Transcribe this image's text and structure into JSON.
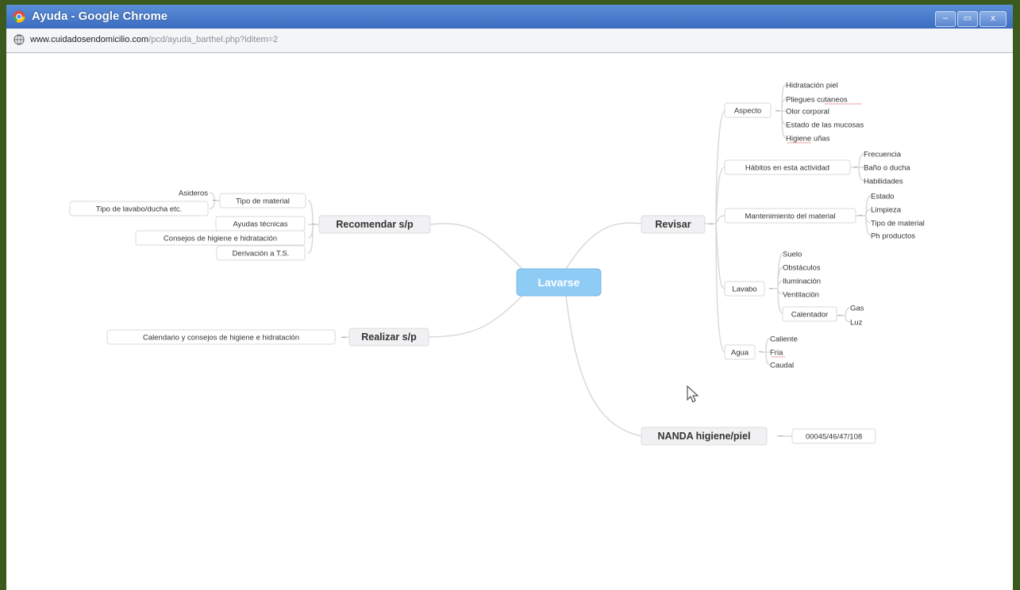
{
  "window": {
    "title": "Ayuda - Google Chrome",
    "controls": {
      "minimize": "–",
      "maximize": "▭",
      "close": "x"
    }
  },
  "address": {
    "domain": "www.cuidadosendomicilio.com",
    "path": "/pcd/ayuda_barthel.php?iditem=2"
  },
  "mindmap": {
    "central": "Lavarse",
    "revisar": {
      "label": "Revisar",
      "aspecto": {
        "label": "Aspecto",
        "items": [
          "Hidratación piel",
          "Pliegues cutaneos",
          "Olor corporal",
          "Estado de las mucosas",
          "Higiene uñas"
        ]
      },
      "habitos": {
        "label": "Hábitos en esta actividad",
        "items": [
          "Frecuencia",
          "Baño o ducha",
          "Habilidades"
        ]
      },
      "mantenimiento": {
        "label": "Mantenimiento del material",
        "items": [
          "Estado",
          "Limpieza",
          "Tipo de material",
          "Ph productos"
        ]
      },
      "lavabo": {
        "label": "Lavabo",
        "items": [
          "Suelo",
          "Obstáculos",
          "Iluminación",
          "Ventilación"
        ],
        "calentador": {
          "label": "Calentador",
          "items": [
            "Gas",
            "Luz"
          ]
        }
      },
      "agua": {
        "label": "Agua",
        "items": [
          "Caliente",
          "Fria",
          "Caudal"
        ]
      }
    },
    "nanda": {
      "label": "NANDA higiene/piel",
      "code": "00045/46/47/108"
    },
    "recomendar": {
      "label": "Recomendar s/p",
      "tipo_material": {
        "label": "Tipo de material",
        "items": [
          "Asideros",
          "Tipo de lavabo/ducha etc."
        ]
      },
      "ayudas": "Ayudas técnicas",
      "consejos": "Consejos de higiene e hidratación",
      "derivacion": "Derivación a T.S."
    },
    "realizar": {
      "label": "Realizar s/p",
      "item": "Calendario y consejos  de higiene e hidratación"
    }
  },
  "colors": {
    "central_fill": "#8ecbf5",
    "line": "#d6d6d6",
    "titlebar": "#4a7dcf",
    "frame": "#3c5a1e"
  }
}
